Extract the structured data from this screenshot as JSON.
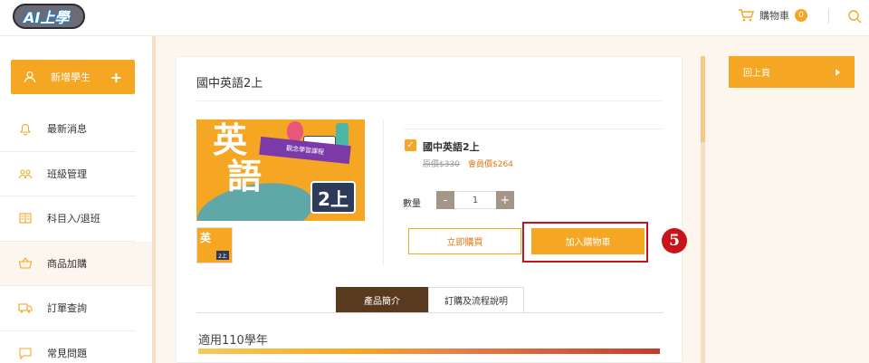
{
  "header": {
    "logo_text": "AI上學",
    "cart_label": "購物車",
    "cart_count": "0"
  },
  "sidebar": {
    "add_student_label": "新增學生",
    "add_student_plus": "+",
    "items": [
      {
        "label": "最新消息",
        "icon": "bell-icon"
      },
      {
        "label": "班級管理",
        "icon": "people-icon"
      },
      {
        "label": "科目入/退班",
        "icon": "book-icon"
      },
      {
        "label": "商品加購",
        "icon": "basket-icon",
        "active": true
      },
      {
        "label": "訂單查詢",
        "icon": "truck-icon"
      },
      {
        "label": "常見問題",
        "icon": "chat-icon"
      }
    ]
  },
  "product": {
    "title": "國中英語2上",
    "cover": {
      "big_char_1": "英",
      "big_char_2": "語",
      "ribbon_text": "觀念學習課程",
      "volume": "2上"
    },
    "name": "國中英語2上",
    "original_price": "原價$330",
    "member_price": "會員價$264",
    "quantity_label": "數量",
    "quantity_value": "1",
    "minus": "-",
    "plus": "+",
    "buy_now_label": "立即購買",
    "add_to_cart_label": "加入購物車",
    "step_badge": "5",
    "tabs": [
      "產品簡介",
      "訂購及流程說明"
    ],
    "apply_text": "適用110學年"
  },
  "right": {
    "back_label": "回上頁"
  },
  "colors": {
    "accent": "#f5a623",
    "tab_active": "#5a3a1e",
    "highlight": "#c8131b"
  }
}
